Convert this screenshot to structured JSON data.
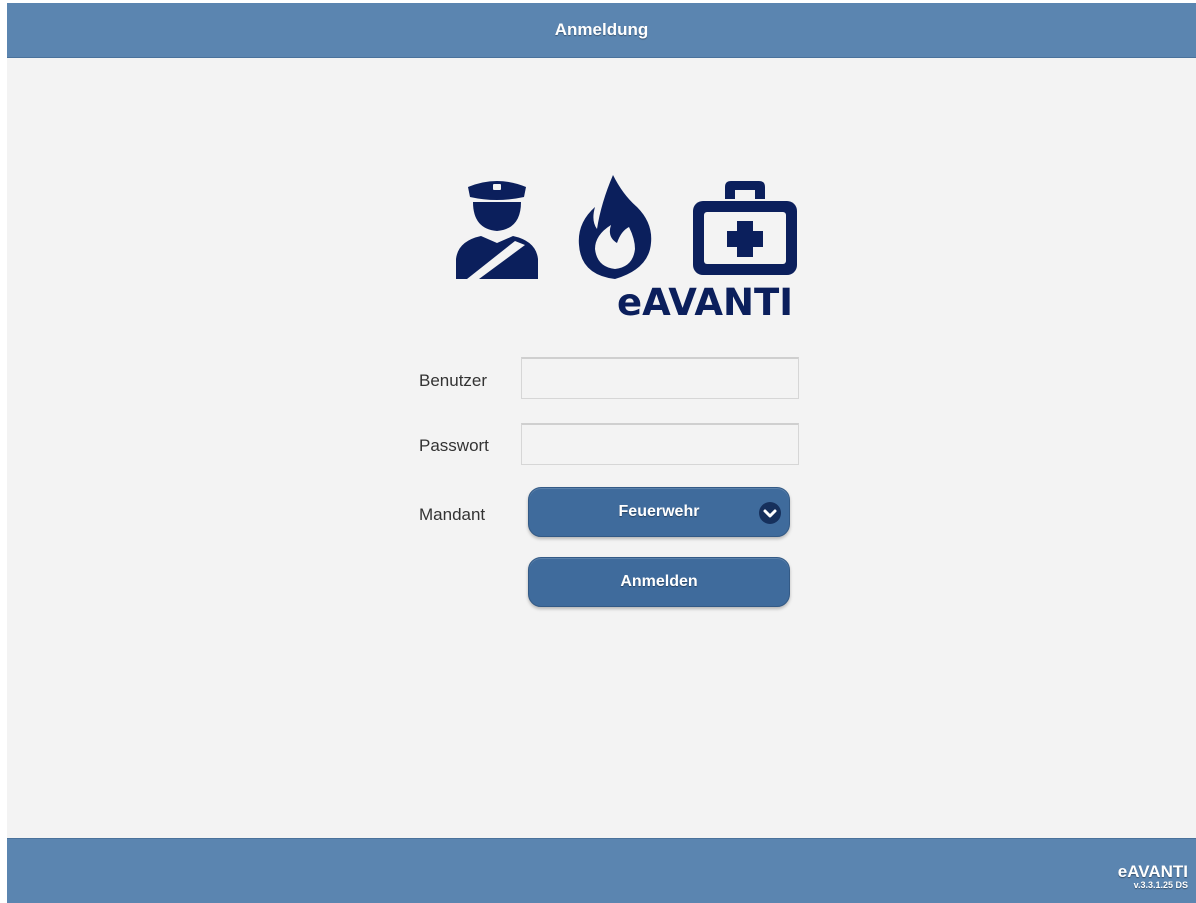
{
  "header": {
    "title": "Anmeldung"
  },
  "logo": {
    "text": "eAVANTI",
    "icons": [
      "police-officer-icon",
      "fire-icon",
      "first-aid-kit-icon"
    ],
    "color": "#0b1f5c"
  },
  "form": {
    "user_label": "Benutzer",
    "user_value": "",
    "password_label": "Passwort",
    "password_value": "",
    "client_label": "Mandant",
    "client_selected": "Feuerwehr",
    "submit_label": "Anmelden"
  },
  "footer": {
    "brand": "eAVANTI",
    "version": "v.3.3.1.25 DS"
  },
  "colors": {
    "bar": "#5b85b0",
    "button": "#3f6b9c",
    "background": "#f3f3f3",
    "logo": "#0b1f5c"
  }
}
